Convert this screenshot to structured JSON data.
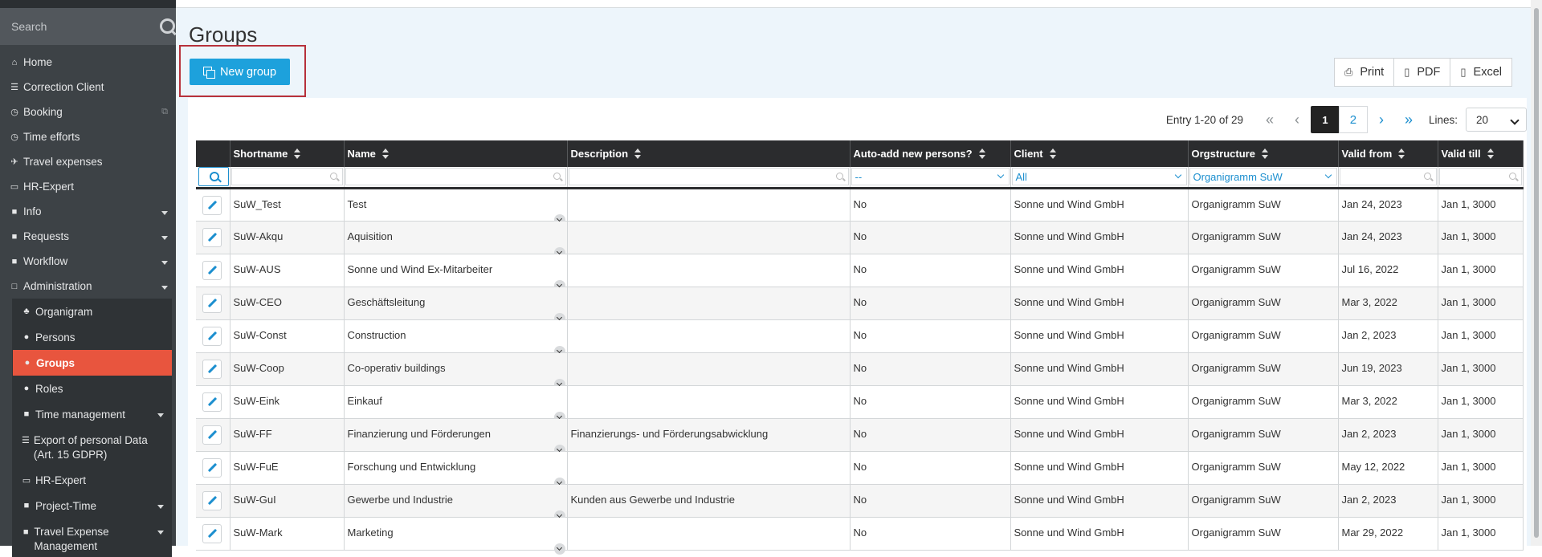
{
  "sidebar": {
    "search_placeholder": "Search",
    "items": [
      {
        "label": "Home",
        "icon": "home-icon"
      },
      {
        "label": "Correction Client",
        "icon": "list-icon"
      },
      {
        "label": "Booking",
        "icon": "clock-icon"
      },
      {
        "label": "Time efforts",
        "icon": "clock-icon"
      },
      {
        "label": "Travel expenses",
        "icon": "plane-icon"
      },
      {
        "label": "HR-Expert",
        "icon": "monitor-icon"
      },
      {
        "label": "Info",
        "icon": "folder-icon"
      },
      {
        "label": "Requests",
        "icon": "folder-icon"
      },
      {
        "label": "Workflow",
        "icon": "folder-icon"
      },
      {
        "label": "Administration",
        "icon": "folder-open-icon"
      }
    ],
    "subitems": [
      {
        "label": "Organigram",
        "icon": "sitemap-icon"
      },
      {
        "label": "Persons",
        "icon": "user-icon"
      },
      {
        "label": "Groups",
        "icon": "users-icon"
      },
      {
        "label": "Roles",
        "icon": "user-icon"
      },
      {
        "label": "Time management",
        "icon": "folder-icon"
      },
      {
        "label": "Export of personal Data (Art. 15 GDPR)",
        "icon": "list-icon"
      },
      {
        "label": "HR-Expert",
        "icon": "monitor-icon"
      },
      {
        "label": "Project-Time",
        "icon": "folder-icon"
      },
      {
        "label": "Travel Expense Management",
        "icon": "folder-icon"
      }
    ]
  },
  "page": {
    "title": "Groups",
    "new_group_label": "New group",
    "export": {
      "print": "Print",
      "pdf": "PDF",
      "excel": "Excel"
    }
  },
  "pager": {
    "entry_text": "Entry 1-20 of 29",
    "pages": [
      "1",
      "2"
    ],
    "current_page": "1",
    "lines_label": "Lines:",
    "lines_value": "20"
  },
  "table": {
    "columns": [
      "Shortname",
      "Name",
      "Description",
      "Auto-add new persons?",
      "Client",
      "Orgstructure",
      "Valid from",
      "Valid till"
    ],
    "filters": {
      "auto_add": "--",
      "client": "All",
      "orgstructure": "Organigramm SuW"
    },
    "rows": [
      [
        "SuW_Test",
        "Test",
        "",
        "No",
        "Sonne und Wind GmbH",
        "Organigramm SuW",
        "Jan 24, 2023",
        "Jan 1, 3000"
      ],
      [
        "SuW-Akqu",
        "Aquisition",
        "",
        "No",
        "Sonne und Wind GmbH",
        "Organigramm SuW",
        "Jan 24, 2023",
        "Jan 1, 3000"
      ],
      [
        "SuW-AUS",
        "Sonne und Wind Ex-Mitarbeiter",
        "",
        "No",
        "Sonne und Wind GmbH",
        "Organigramm SuW",
        "Jul 16, 2022",
        "Jan 1, 3000"
      ],
      [
        "SuW-CEO",
        "Geschäftsleitung",
        "",
        "No",
        "Sonne und Wind GmbH",
        "Organigramm SuW",
        "Mar 3, 2022",
        "Jan 1, 3000"
      ],
      [
        "SuW-Const",
        "Construction",
        "",
        "No",
        "Sonne und Wind GmbH",
        "Organigramm SuW",
        "Jan 2, 2023",
        "Jan 1, 3000"
      ],
      [
        "SuW-Coop",
        "Co-operativ buildings",
        "",
        "No",
        "Sonne und Wind GmbH",
        "Organigramm SuW",
        "Jun 19, 2023",
        "Jan 1, 3000"
      ],
      [
        "SuW-Eink",
        "Einkauf",
        "",
        "No",
        "Sonne und Wind GmbH",
        "Organigramm SuW",
        "Mar 3, 2022",
        "Jan 1, 3000"
      ],
      [
        "SuW-FF",
        "Finanzierung und Förderungen",
        "Finanzierungs- und Förderungsabwicklung",
        "No",
        "Sonne und Wind GmbH",
        "Organigramm SuW",
        "Jan 2, 2023",
        "Jan 1, 3000"
      ],
      [
        "SuW-FuE",
        "Forschung und Entwicklung",
        "",
        "No",
        "Sonne und Wind GmbH",
        "Organigramm SuW",
        "May 12, 2022",
        "Jan 1, 3000"
      ],
      [
        "SuW-GuI",
        "Gewerbe und Industrie",
        "Kunden aus Gewerbe und Industrie",
        "No",
        "Sonne und Wind GmbH",
        "Organigramm SuW",
        "Jan 2, 2023",
        "Jan 1, 3000"
      ],
      [
        "SuW-Mark",
        "Marketing",
        "",
        "No",
        "Sonne und Wind GmbH",
        "Organigramm SuW",
        "Mar 29, 2022",
        "Jan 1, 3000"
      ]
    ]
  },
  "colors": {
    "accent": "#1da1dc",
    "active_nav": "#e8553e",
    "sidebar_bg": "#3d4246",
    "header_bg": "#2b2c2e",
    "highlight_border": "#b7313b"
  }
}
